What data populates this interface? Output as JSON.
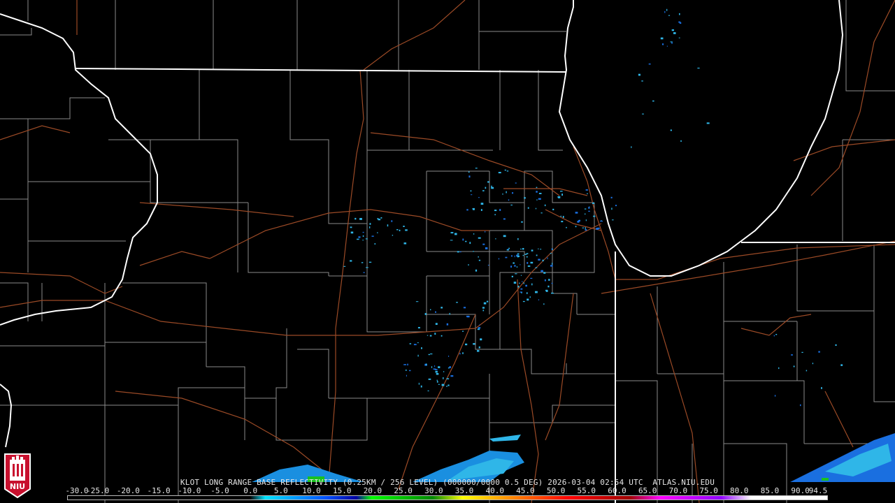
{
  "product_caption": "KLOT LONG RANGE BASE REFLECTIVITY (0.25KM / 256 LEVEL) (000000/0000 0.5 DEG) 2026-03-04 02:54 UTC  ATLAS.NIU.EDU",
  "scale": {
    "labels": [
      "-30.0",
      "-25.0",
      "-20.0",
      "-15.0",
      "-10.0",
      "-5.0",
      "0.0",
      "5.0",
      "10.0",
      "15.0",
      "20.0",
      "25.0",
      "30.0",
      "35.0",
      "40.0",
      "45.0",
      "50.0",
      "55.0",
      "60.0",
      "65.0",
      "70.0",
      "75.0",
      "80.0",
      "85.0",
      "90.0",
      "94.5"
    ],
    "values": [
      -30,
      -25,
      -20,
      -15,
      -10,
      -5,
      0,
      5,
      10,
      15,
      20,
      25,
      30,
      35,
      40,
      45,
      50,
      55,
      60,
      65,
      70,
      75,
      80,
      85,
      90,
      94.5
    ],
    "colors": {
      "none": "#000000",
      "light_cyan": "#00e4ff",
      "blue": "#0050ff",
      "green": "#00d000",
      "yellow": "#ffff00",
      "orange": "#ff9000",
      "red": "#ff0000",
      "magenta": "#ff00ff",
      "white": "#ffffff"
    }
  },
  "logo": {
    "text": "NIU",
    "color": "#c8102e"
  },
  "map_colors": {
    "state_lines": "#ffffff",
    "county_lines": "#9a9a9a",
    "highways": "#a0522d",
    "echo_light": "#2fb6e8",
    "echo_medium": "#1a6fe0",
    "echo_green": "#19c21e"
  }
}
